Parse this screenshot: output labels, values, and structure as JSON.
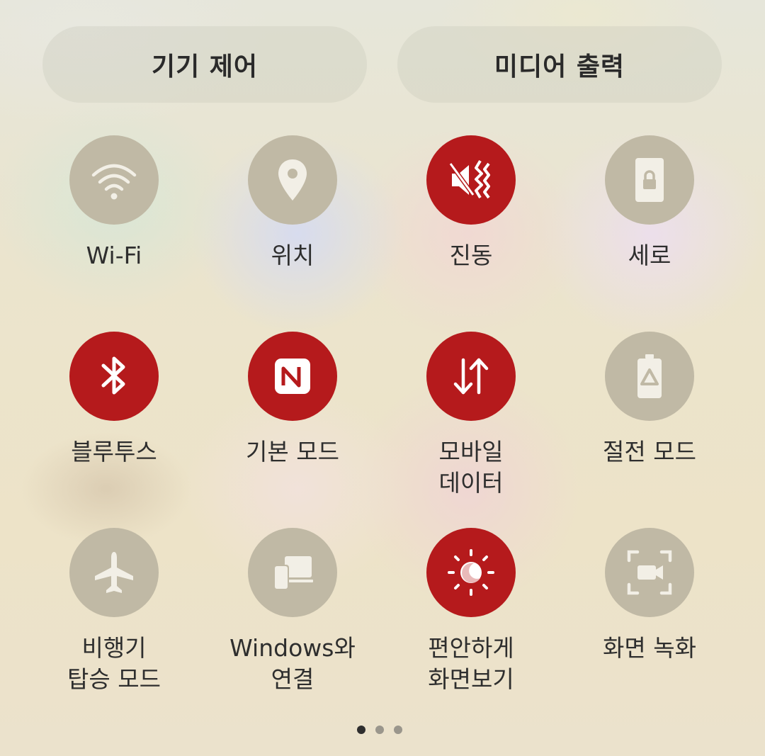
{
  "top_buttons": {
    "device_control": "기기 제어",
    "media_output": "미디어 출력"
  },
  "tiles": [
    {
      "label_lines": [
        "Wi-Fi"
      ],
      "state": "off",
      "icon": "wifi-icon"
    },
    {
      "label_lines": [
        "위치"
      ],
      "state": "off",
      "icon": "location-pin-icon"
    },
    {
      "label_lines": [
        "진동"
      ],
      "state": "on",
      "icon": "vibrate-icon"
    },
    {
      "label_lines": [
        "세로"
      ],
      "state": "off",
      "icon": "portrait-lock-icon"
    },
    {
      "label_lines": [
        "블루투스"
      ],
      "state": "on",
      "icon": "bluetooth-icon"
    },
    {
      "label_lines": [
        "기본 모드"
      ],
      "state": "on",
      "icon": "nfc-icon"
    },
    {
      "label_lines": [
        "모바일",
        "데이터"
      ],
      "state": "on",
      "icon": "mobile-data-icon"
    },
    {
      "label_lines": [
        "절전 모드"
      ],
      "state": "off",
      "icon": "power-saving-icon"
    },
    {
      "label_lines": [
        "비행기",
        "탑승 모드"
      ],
      "state": "off",
      "icon": "airplane-icon"
    },
    {
      "label_lines": [
        "Windows와",
        "연결"
      ],
      "state": "off",
      "icon": "link-to-windows-icon"
    },
    {
      "label_lines": [
        "편안하게",
        "화면보기"
      ],
      "state": "on",
      "icon": "eye-comfort-icon"
    },
    {
      "label_lines": [
        "화면 녹화"
      ],
      "state": "off",
      "icon": "screen-recorder-icon"
    }
  ],
  "page_indicator": {
    "pages": 3,
    "current": 1
  },
  "colors": {
    "tile_on": "#b51a1c",
    "tile_off": "#c0b9a5",
    "text": "#2e2e2e"
  }
}
